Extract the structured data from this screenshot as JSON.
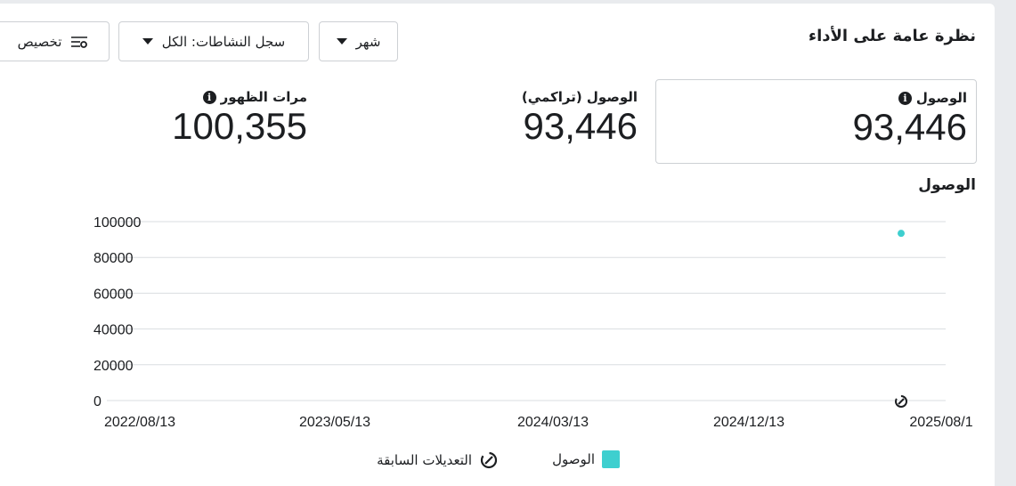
{
  "header": {
    "title": "نظرة عامة على الأداء",
    "period_label": "شهر",
    "activity_label": "سجل النشاطات: الكل",
    "customize_label": "تخصيص"
  },
  "metrics": [
    {
      "label": "الوصول",
      "value": "93,446"
    },
    {
      "label": "الوصول (تراكمي)",
      "value": "93,446"
    },
    {
      "label": "مرات الظهور",
      "value": "100,355"
    }
  ],
  "chart_title": "الوصول",
  "legend": {
    "series_label": "الوصول",
    "edits_label": "التعديلات السابقة"
  },
  "colors": {
    "series": "#3ecfcf",
    "grid": "#dadde1",
    "text": "#1c1e21"
  },
  "chart_data": {
    "type": "scatter",
    "y_ticks": [
      "0",
      "20000",
      "40000",
      "60000",
      "80000",
      "100000"
    ],
    "x_ticks": [
      "2022/08/13",
      "2023/05/13",
      "2024/03/13",
      "2024/12/13",
      "2025/08/1"
    ],
    "ylim": [
      0,
      100000
    ],
    "series": [
      {
        "name": "الوصول",
        "points": [
          {
            "x": "2025/08",
            "y": 93446
          }
        ]
      }
    ],
    "annotations": [
      {
        "type": "edit-marker",
        "x": "2025/08",
        "label": "التعديلات السابقة"
      }
    ],
    "grid": true,
    "legend_position": "bottom"
  }
}
